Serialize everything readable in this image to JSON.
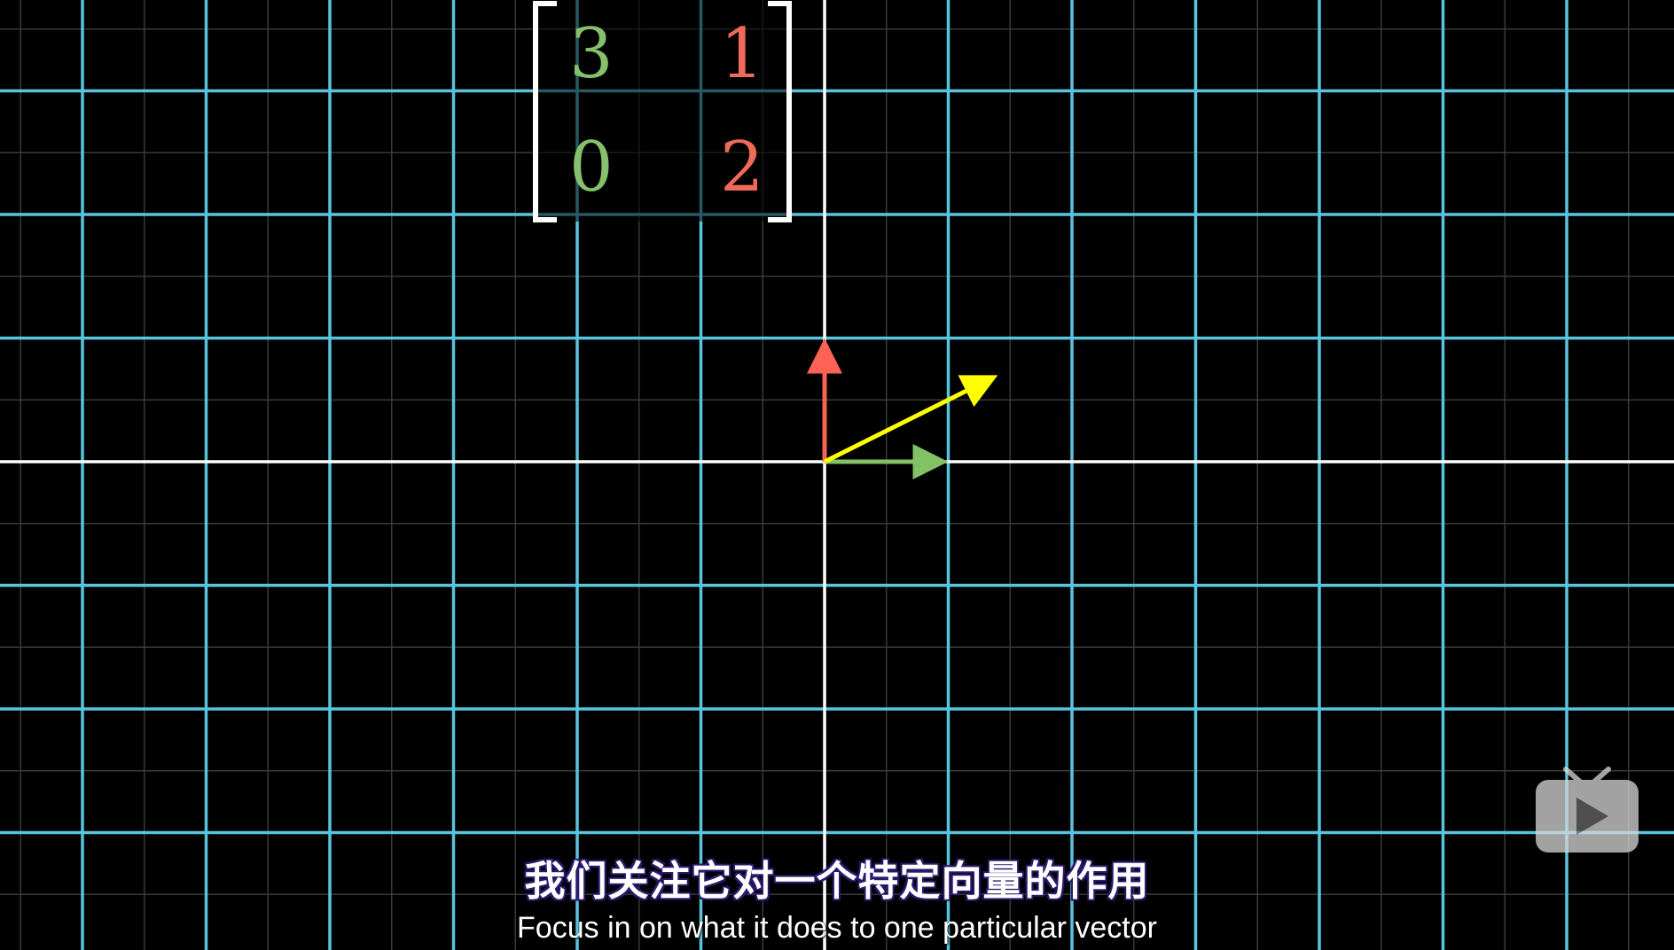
{
  "matrix": {
    "entries": [
      {
        "row": 0,
        "col": 0,
        "text": "3",
        "color": "#86c06c"
      },
      {
        "row": 0,
        "col": 1,
        "text": "1",
        "color": "#f06a5a"
      },
      {
        "row": 1,
        "col": 0,
        "text": "0",
        "color": "#86c06c"
      },
      {
        "row": 1,
        "col": 1,
        "text": "2",
        "color": "#f06a5a"
      }
    ]
  },
  "vectors": {
    "i_hat": {
      "x": 1,
      "y": 0,
      "color": "#83c167"
    },
    "j_hat": {
      "x": 0,
      "y": 1,
      "color": "#fc6255"
    },
    "v": {
      "x": 1.4,
      "y": 0.7,
      "color": "#ffff00"
    }
  },
  "grid": {
    "major_color": "#58c4dd",
    "axis_color": "#ffffff",
    "minor_color": "#3a3a3a"
  },
  "subtitles": {
    "zh": "我们关注它对一个特定向量的作用",
    "en": "Focus in on what it does to one particular vector"
  },
  "watermark": {
    "icon": "bilibili-tv-play-icon"
  }
}
